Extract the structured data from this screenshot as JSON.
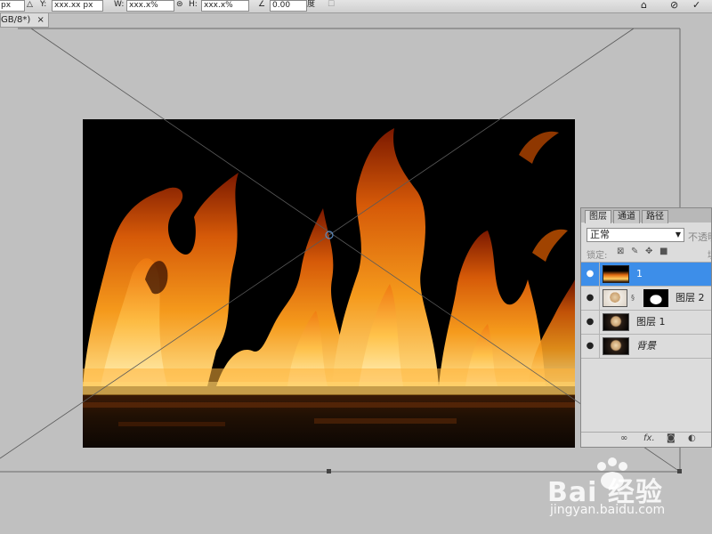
{
  "options_bar": {
    "x_value": "px",
    "y_value": "xxx.xx px",
    "w_value": "xxx.x%",
    "h_value": "xxx.x%",
    "angle_value": "0.00",
    "degree_symbol": "度"
  },
  "document": {
    "tab_title": "GB/8*)",
    "tab_close": "×"
  },
  "layers_panel": {
    "tabs": [
      "图层",
      "通道",
      "路径"
    ],
    "blend_mode": "正常",
    "opacity_label": "不透明",
    "lock_label": "锁定:",
    "fill_label": "填",
    "layers": [
      {
        "name": "1",
        "selected": true,
        "italic": false,
        "thumb": "fire"
      },
      {
        "name": "图层 2",
        "selected": false,
        "italic": false,
        "thumb": "portrait-mask"
      },
      {
        "name": "图层 1",
        "selected": false,
        "italic": false,
        "thumb": "portrait"
      },
      {
        "name": "背景",
        "selected": false,
        "italic": true,
        "thumb": "portrait"
      }
    ],
    "footer_icons": [
      "link-icon",
      "fx-icon",
      "mask-icon",
      "adjustment-icon"
    ]
  },
  "watermark": {
    "brand": "Bai  经验",
    "url": "jingyan.baidu.com"
  },
  "colors": {
    "workspace": "#c0c0c0",
    "selection": "#3d8ee9",
    "fire_core": "#ffd36b",
    "fire_mid": "#f08a14",
    "fire_edge": "#a12a00"
  }
}
